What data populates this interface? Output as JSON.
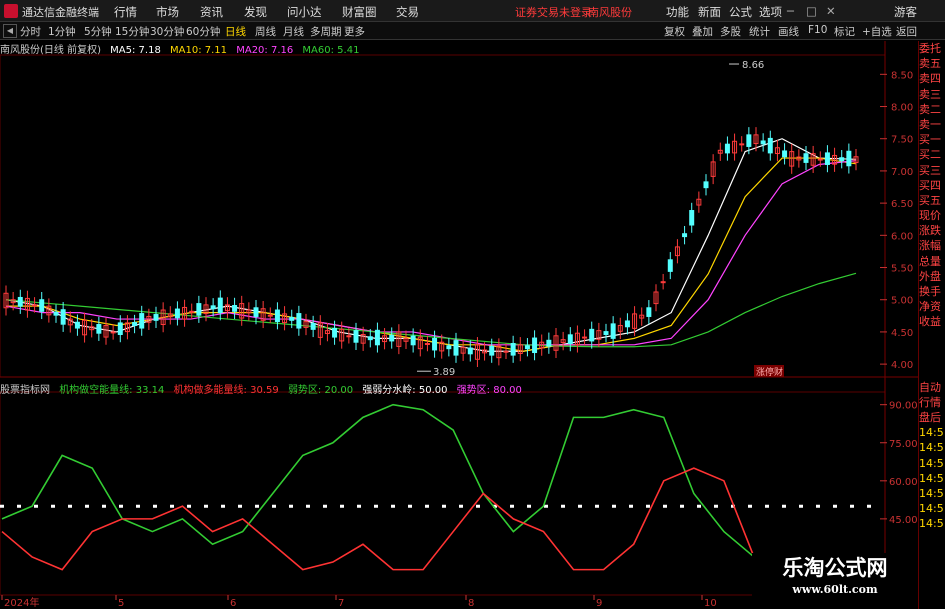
{
  "menubar": {
    "app_title": "通达信金融终端",
    "menus": [
      "行情",
      "市场",
      "资讯",
      "发现",
      "问小达",
      "财富圈",
      "交易"
    ],
    "status_login": "证券交易未登录",
    "status_stock": "南风股份",
    "right_menus": [
      "功能",
      "新面",
      "公式",
      "选项"
    ],
    "guest": "游客"
  },
  "toolbar": {
    "periods": [
      "分时",
      "1分钟",
      "5分钟",
      "15分钟",
      "30分钟",
      "60分钟",
      "日线",
      "周线",
      "月线",
      "多周期",
      "更多"
    ],
    "active_period": "日线",
    "right_buttons": [
      "复权",
      "叠加",
      "多股",
      "统计",
      "画线",
      "F10",
      "标记",
      "+自选",
      "返回"
    ]
  },
  "main_chart": {
    "stock_label": "南风股份(日线 前复权)",
    "ma_items": [
      {
        "label": "MA5: 7.18",
        "color": "#ffffff"
      },
      {
        "label": "MA10: 7.11",
        "color": "#ffd700"
      },
      {
        "label": "MA20: 7.16",
        "color": "#ff44ff"
      },
      {
        "label": "MA60: 5.41",
        "color": "#33cc33"
      }
    ],
    "high_label": "8.66",
    "low_label": "3.89",
    "badge": "涨停财",
    "y_ticks": [
      "8.50",
      "8.00",
      "7.50",
      "7.00",
      "6.50",
      "6.00",
      "5.50",
      "5.00",
      "4.50",
      "4.00"
    ]
  },
  "indicator": {
    "name": "股票指标网",
    "items": [
      {
        "label": "机构做空能量线: 33.14",
        "color": "#33cc33"
      },
      {
        "label": "机构做多能量线: 30.59",
        "color": "#ff3333"
      },
      {
        "label": "弱势区: 20.00",
        "color": "#33cc33"
      },
      {
        "label": "强弱分水岭: 50.00",
        "color": "#ffffff"
      },
      {
        "label": "强势区: 80.00",
        "color": "#ff44ff"
      }
    ],
    "y_ticks": [
      "90.00",
      "75.00",
      "60.00",
      "45.00"
    ]
  },
  "x_axis": [
    "2024年",
    "5",
    "6",
    "7",
    "8",
    "9",
    "10"
  ],
  "right_panel": [
    "委托",
    "卖五",
    "卖四",
    "卖三",
    "卖二",
    "卖一",
    "买一",
    "买二",
    "买三",
    "买四",
    "买五",
    "现价",
    "涨跌",
    "涨幅",
    "总量",
    "外盘",
    "换手",
    "净资",
    "收益"
  ],
  "right_panel_bottom": [
    "自动",
    "行情",
    "盘后",
    "14:5",
    "14:5",
    "14:5",
    "14:5",
    "14:5",
    "14:5",
    "14:5"
  ],
  "watermark": {
    "line1": "乐淘公式网",
    "line2": "www.60lt.com"
  },
  "chart_data": [
    {
      "type": "line",
      "title": "南风股份(日线 前复权)",
      "ylim": [
        3.8,
        8.8
      ],
      "series": [
        {
          "name": "MA5",
          "color": "#ffffff",
          "values": [
            5.0,
            4.9,
            4.6,
            4.5,
            4.7,
            4.8,
            4.9,
            4.8,
            4.7,
            4.5,
            4.4,
            4.4,
            4.3,
            4.2,
            4.2,
            4.3,
            4.4,
            4.5,
            4.8,
            6.0,
            7.3,
            7.5,
            7.2,
            7.18
          ]
        },
        {
          "name": "MA10",
          "color": "#ffd700",
          "values": [
            4.9,
            4.9,
            4.7,
            4.6,
            4.7,
            4.8,
            4.8,
            4.8,
            4.7,
            4.6,
            4.5,
            4.4,
            4.3,
            4.3,
            4.2,
            4.3,
            4.3,
            4.4,
            4.6,
            5.4,
            6.6,
            7.2,
            7.2,
            7.11
          ]
        },
        {
          "name": "MA20",
          "color": "#ff44ff",
          "values": [
            4.9,
            4.8,
            4.8,
            4.7,
            4.7,
            4.7,
            4.8,
            4.7,
            4.7,
            4.6,
            4.5,
            4.5,
            4.4,
            4.3,
            4.3,
            4.3,
            4.3,
            4.3,
            4.4,
            5.0,
            6.0,
            6.8,
            7.1,
            7.16
          ]
        },
        {
          "name": "MA60",
          "color": "#33cc33",
          "values": [
            5.0,
            4.95,
            4.9,
            4.85,
            4.8,
            4.75,
            4.7,
            4.65,
            4.6,
            4.55,
            4.5,
            4.45,
            4.4,
            4.35,
            4.3,
            4.28,
            4.27,
            4.27,
            4.3,
            4.5,
            4.8,
            5.05,
            5.25,
            5.41
          ]
        }
      ]
    },
    {
      "type": "line",
      "title": "股票指标网",
      "ylim": [
        15,
        95
      ],
      "series": [
        {
          "name": "机构做空能量线",
          "color": "#33cc33",
          "values": [
            45,
            50,
            70,
            65,
            45,
            40,
            45,
            35,
            40,
            55,
            70,
            75,
            85,
            90,
            88,
            80,
            55,
            40,
            50,
            85,
            85,
            88,
            85,
            55,
            40,
            30
          ]
        },
        {
          "name": "机构做多能量线",
          "color": "#ff3333",
          "values": [
            40,
            30,
            25,
            40,
            45,
            45,
            50,
            40,
            45,
            35,
            25,
            28,
            35,
            25,
            25,
            40,
            55,
            45,
            40,
            25,
            25,
            35,
            60,
            65,
            60,
            30
          ]
        }
      ],
      "reference_lines": [
        20,
        50,
        80
      ]
    }
  ]
}
